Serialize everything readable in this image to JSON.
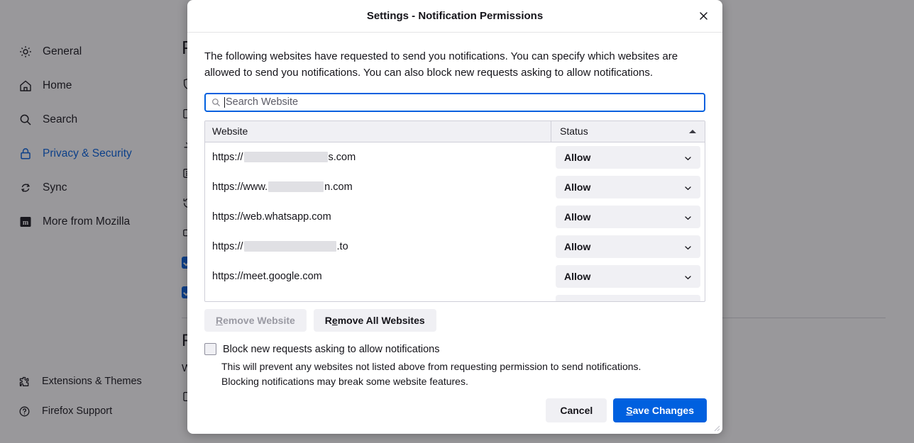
{
  "background": {
    "sidebar": {
      "items": [
        {
          "label": "General",
          "icon": "gear-icon",
          "selected": false
        },
        {
          "label": "Home",
          "icon": "home-icon",
          "selected": false
        },
        {
          "label": "Search",
          "icon": "search-icon",
          "selected": false
        },
        {
          "label": "Privacy & Security",
          "icon": "lock-icon",
          "selected": true
        },
        {
          "label": "Sync",
          "icon": "sync-icon",
          "selected": false
        },
        {
          "label": "More from Mozilla",
          "icon": "mozilla-icon",
          "selected": false
        }
      ],
      "bottom_items": [
        {
          "label": "Extensions & Themes",
          "icon": "puzzle-icon"
        },
        {
          "label": "Firefox Support",
          "icon": "question-circle-icon"
        }
      ]
    },
    "main": {
      "heading": "P",
      "section_heading": "F",
      "paragraph": "We strive to provide you with choices and collect only what we need to provide and"
    }
  },
  "dialog": {
    "title": "Settings - Notification Permissions",
    "close_icon": "close-icon",
    "description": "The following websites have requested to send you notifications. You can specify which websites are allowed to send you notifications. You can also block new requests asking to allow notifications.",
    "search": {
      "placeholder": "Search Website",
      "value": "",
      "icon": "search-icon",
      "focused": true
    },
    "table": {
      "columns": [
        {
          "key": "website",
          "label": "Website",
          "sorted": false
        },
        {
          "key": "status",
          "label": "Status",
          "sorted": true,
          "sort_direction": "ascending"
        }
      ],
      "rows": [
        {
          "website_prefix": "https://",
          "website_redacted_width": 118,
          "website_suffix": "s.com",
          "status": "Allow"
        },
        {
          "website_prefix": "https://www.",
          "website_redacted_width": 78,
          "website_suffix": "n.com",
          "status": "Allow"
        },
        {
          "website_prefix": "https://web.whatsapp.com",
          "website_redacted_width": 0,
          "website_suffix": "",
          "status": "Allow"
        },
        {
          "website_prefix": "https://",
          "website_redacted_width": 130,
          "website_suffix": ".to",
          "status": "Allow"
        },
        {
          "website_prefix": "https://meet.google.com",
          "website_redacted_width": 0,
          "website_suffix": "",
          "status": "Allow"
        },
        {
          "website_prefix": "",
          "website_redacted_width": 0,
          "website_suffix": "",
          "status": ""
        }
      ]
    },
    "row_actions": {
      "remove_website": {
        "label": "Remove Website",
        "accesskey": "R",
        "enabled": false
      },
      "remove_all": {
        "label": "Remove All Websites",
        "accesskey": "e",
        "enabled": true
      }
    },
    "block_checkbox": {
      "label": "Block new requests asking to allow notifications",
      "checked": false,
      "help_line1": "This will prevent any websites not listed above from requesting permission to send notifications.",
      "help_line2": "Blocking notifications may break some website features."
    },
    "footer": {
      "cancel_label": "Cancel",
      "save_label": "Save Changes",
      "save_accesskey": "S"
    }
  },
  "colors": {
    "accent": "#0060df",
    "text": "#15141a",
    "surface": "#f0f0f4",
    "border": "#cfcfd8",
    "disabled_text": "#9a9aa3",
    "redaction": "#e0e0e4"
  }
}
